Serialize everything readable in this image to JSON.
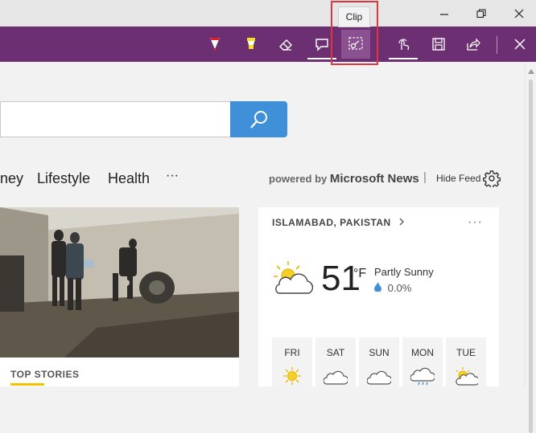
{
  "window": {
    "minimize_icon": "minimize-icon",
    "maximize_icon": "restore-icon",
    "close_icon": "close-icon"
  },
  "tooltip": {
    "text": "Clip"
  },
  "toolbar": {
    "color": "#6b2f72",
    "tools": [
      {
        "name": "ballpoint-pen",
        "icon": "pen-icon"
      },
      {
        "name": "highlighter",
        "icon": "highlighter-icon"
      },
      {
        "name": "eraser",
        "icon": "eraser-icon"
      },
      {
        "name": "add-note",
        "icon": "note-icon"
      },
      {
        "name": "clip",
        "icon": "clip-icon",
        "active": true
      },
      {
        "name": "touch-writing",
        "icon": "touch-icon"
      },
      {
        "name": "save",
        "icon": "save-icon"
      },
      {
        "name": "share",
        "icon": "share-icon"
      },
      {
        "name": "exit",
        "icon": "close-icon"
      }
    ]
  },
  "search": {
    "placeholder": "",
    "button_color": "#3f8fd9"
  },
  "nav": {
    "items": [
      "ney",
      "Lifestyle",
      "Health",
      "···"
    ]
  },
  "feed": {
    "powered_by": "powered by",
    "brand": "Microsoft News",
    "separator": "|",
    "hide_feed": "Hide Feed"
  },
  "news": {
    "label": "TOP STORIES"
  },
  "weather": {
    "location": "ISLAMABAD, PAKISTAN",
    "more": "···",
    "temperature": "51",
    "unit": "°F",
    "condition": "Partly Sunny",
    "precipitation": "0.0%",
    "forecast": [
      {
        "day": "FRI",
        "icon": "sun-icon"
      },
      {
        "day": "SAT",
        "icon": "cloud-icon"
      },
      {
        "day": "SUN",
        "icon": "cloud-icon"
      },
      {
        "day": "MON",
        "icon": "rain-cloud-icon"
      },
      {
        "day": "TUE",
        "icon": "partly-sunny-icon"
      }
    ]
  }
}
